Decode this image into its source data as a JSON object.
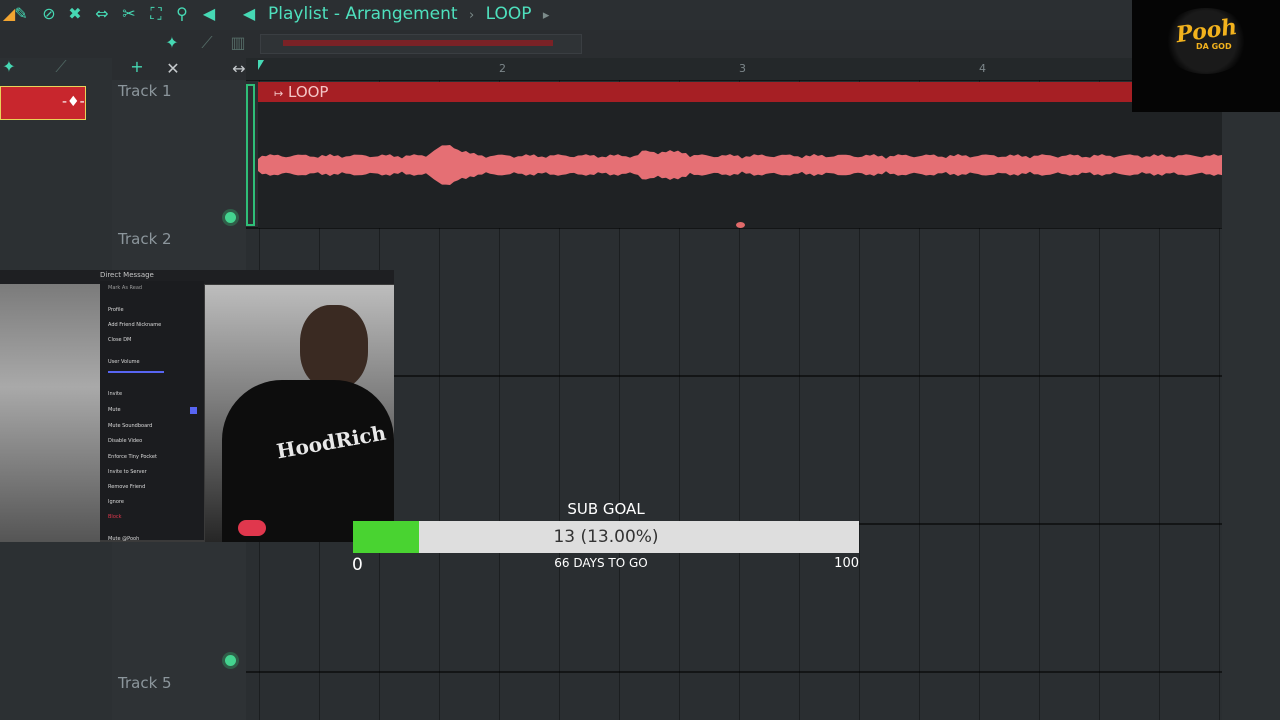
{
  "toolbar": {
    "title_parts": [
      "Playlist - Arrangement",
      "LOOP"
    ],
    "icons": [
      "magnet-icon",
      "paint-icon",
      "delete-icon",
      "mute-icon",
      "slip-icon",
      "slice-icon",
      "select-icon",
      "zoom-icon",
      "playback-icon"
    ]
  },
  "ruler": {
    "bars": [
      "2",
      "3",
      "4"
    ]
  },
  "tracks": [
    {
      "name": "Track 1"
    },
    {
      "name": "Track 2"
    },
    {
      "name": "Track 5"
    }
  ],
  "clip": {
    "label": "LOOP",
    "color": "#a61f24",
    "wave_color": "#e56f74"
  },
  "webcam": {
    "window_title": "Direct Message",
    "menu": [
      "Mark As Read",
      "Profile",
      "Add Friend Nickname",
      "Close DM",
      "User Volume",
      "Invite",
      "Mute",
      "Mute Soundboard",
      "Disable Video",
      "Enforce Tiny Pocket",
      "Invite to Server",
      "Remove Friend",
      "Ignore",
      "Block",
      "Mute @Pooh"
    ],
    "shirt_text": "HoodRich"
  },
  "logo": {
    "text": "Pooh",
    "sub": "DA GOD"
  },
  "sub_goal": {
    "title": "SUB GOAL",
    "current_text": "13 (13.00%)",
    "progress": 0.13,
    "min": "0",
    "max": "100",
    "days": "66 DAYS TO GO",
    "fill_color": "#49d331"
  }
}
